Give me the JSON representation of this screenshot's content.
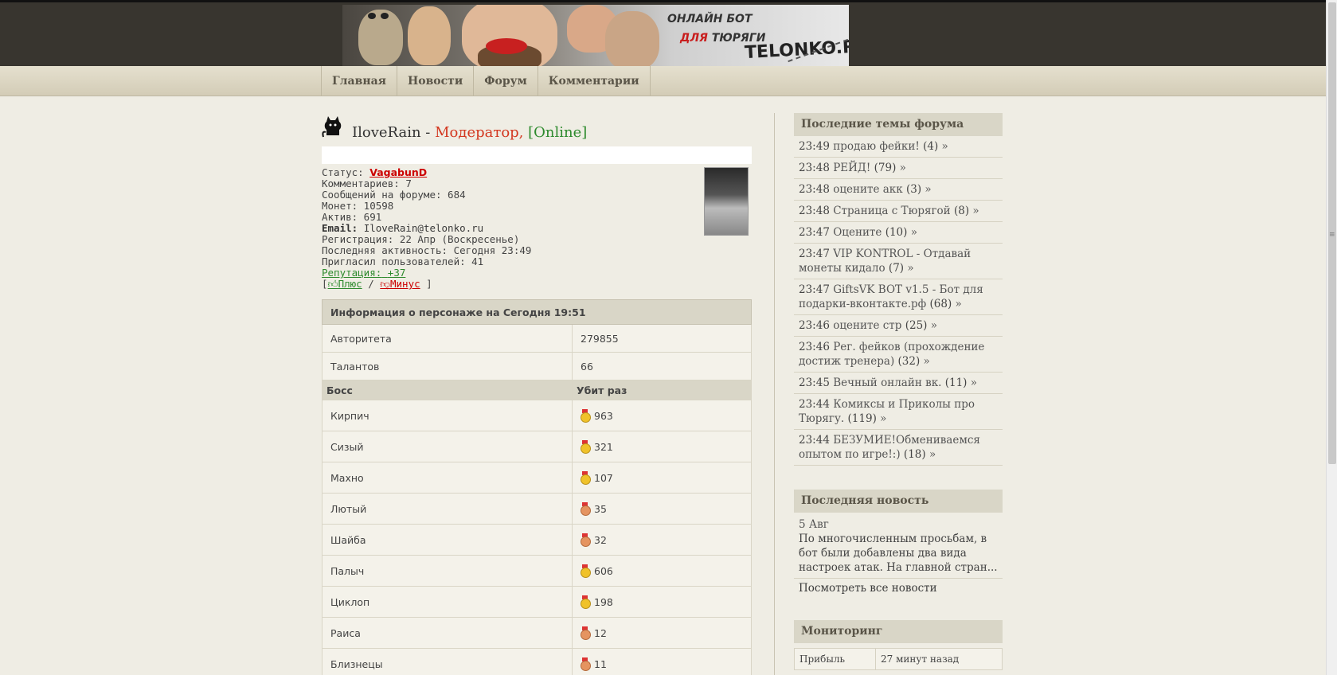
{
  "banner": {
    "line1": "ОНЛАЙН БОТ",
    "line2_prefix": "",
    "line2_highlight": "ДЛЯ",
    "line2_suffix": " ТЮРЯГИ",
    "logo": "TELONKO.RU"
  },
  "nav": {
    "items": [
      "Главная",
      "Новости",
      "Форум",
      "Комментарии"
    ]
  },
  "profile": {
    "role_icon": "cat-silhouette-icon",
    "username": "IloveRain",
    "role_sep": " - ",
    "role": "Модератор,",
    "online": "[Online]",
    "status_label": "Статус: ",
    "status_value": "VagabunD",
    "comments": "Комментариев: 7",
    "forum_posts": "Сообщений на форуме: 684",
    "coins": "Монет: 10598",
    "active": "Актив: 691",
    "email_label": "Email:",
    "email_value": "IloveRain@telonko.ru",
    "registration": "Регистрация: 22 Апр (Воскресенье)",
    "last_activity": "Последняя активность: Сегодня 23:49",
    "invited": "Пригласил пользователей: 41",
    "reputation_label": "Репутация:",
    "reputation_value": "+37",
    "vote_open": "[",
    "plus": "Плюс",
    "vote_sep": " / ",
    "minus": "Минус",
    "vote_close": " ]"
  },
  "character": {
    "caption": "Информация о персонаже на Сегодня 19:51",
    "stats": [
      {
        "label": "Авторитета",
        "value": "279855"
      },
      {
        "label": "Талантов",
        "value": "66"
      }
    ],
    "boss_header": "Босс",
    "kills_header": "Убит раз",
    "bosses": [
      {
        "name": "Кирпич",
        "kills": "963",
        "medal": "gold"
      },
      {
        "name": "Сизый",
        "kills": "321",
        "medal": "gold"
      },
      {
        "name": "Махно",
        "kills": "107",
        "medal": "gold"
      },
      {
        "name": "Лютый",
        "kills": "35",
        "medal": "bronze"
      },
      {
        "name": "Шайба",
        "kills": "32",
        "medal": "bronze"
      },
      {
        "name": "Палыч",
        "kills": "606",
        "medal": "gold"
      },
      {
        "name": "Циклоп",
        "kills": "198",
        "medal": "gold"
      },
      {
        "name": "Раиса",
        "kills": "12",
        "medal": "bronze"
      },
      {
        "name": "Близнецы",
        "kills": "11",
        "medal": "bronze"
      }
    ]
  },
  "sidebar": {
    "forum_title": "Последние темы форума",
    "topics": [
      {
        "time": "23:49",
        "title": "продаю фейки!",
        "count": "(4)"
      },
      {
        "time": "23:48",
        "title": "РЕЙД!",
        "count": "(79)"
      },
      {
        "time": "23:48",
        "title": "оцените акк",
        "count": "(3)"
      },
      {
        "time": "23:48",
        "title": "Страница с Тюрягой",
        "count": "(8)"
      },
      {
        "time": "23:47",
        "title": "Оцените",
        "count": "(10)"
      },
      {
        "time": "23:47",
        "title": "VIP KONTROL - Отдавай монеты кидало",
        "count": "(7)"
      },
      {
        "time": "23:47",
        "title": "GiftsVK BOT v1.5 - Бот для подарки-вконтакте.рф",
        "count": "(68)"
      },
      {
        "time": "23:46",
        "title": "оцените стр",
        "count": "(25)"
      },
      {
        "time": "23:46",
        "title": "Рег. фейков (прохождение достиж тренера)",
        "count": "(32)"
      },
      {
        "time": "23:45",
        "title": "Вечный онлайн вк.",
        "count": "(11)"
      },
      {
        "time": "23:44",
        "title": "Комиксы и Приколы про Тюрягу.",
        "count": "(119)"
      },
      {
        "time": "23:44",
        "title": "БЕЗУМИЕ!Обмениваемся опытом по игре!:)",
        "count": "(18)"
      }
    ],
    "more_glyph": "»",
    "news_title": "Последняя новость",
    "news_date": "5 Авг",
    "news_text": "По многочисленным просьбам, в бот были добавлены два вида настроек атак. На главной стран...",
    "news_all": "Посмотреть все новости",
    "monitor_title": "Мониторинг",
    "monitor_rows": [
      {
        "label": "Прибыль",
        "value": "27 минут назад"
      }
    ]
  }
}
